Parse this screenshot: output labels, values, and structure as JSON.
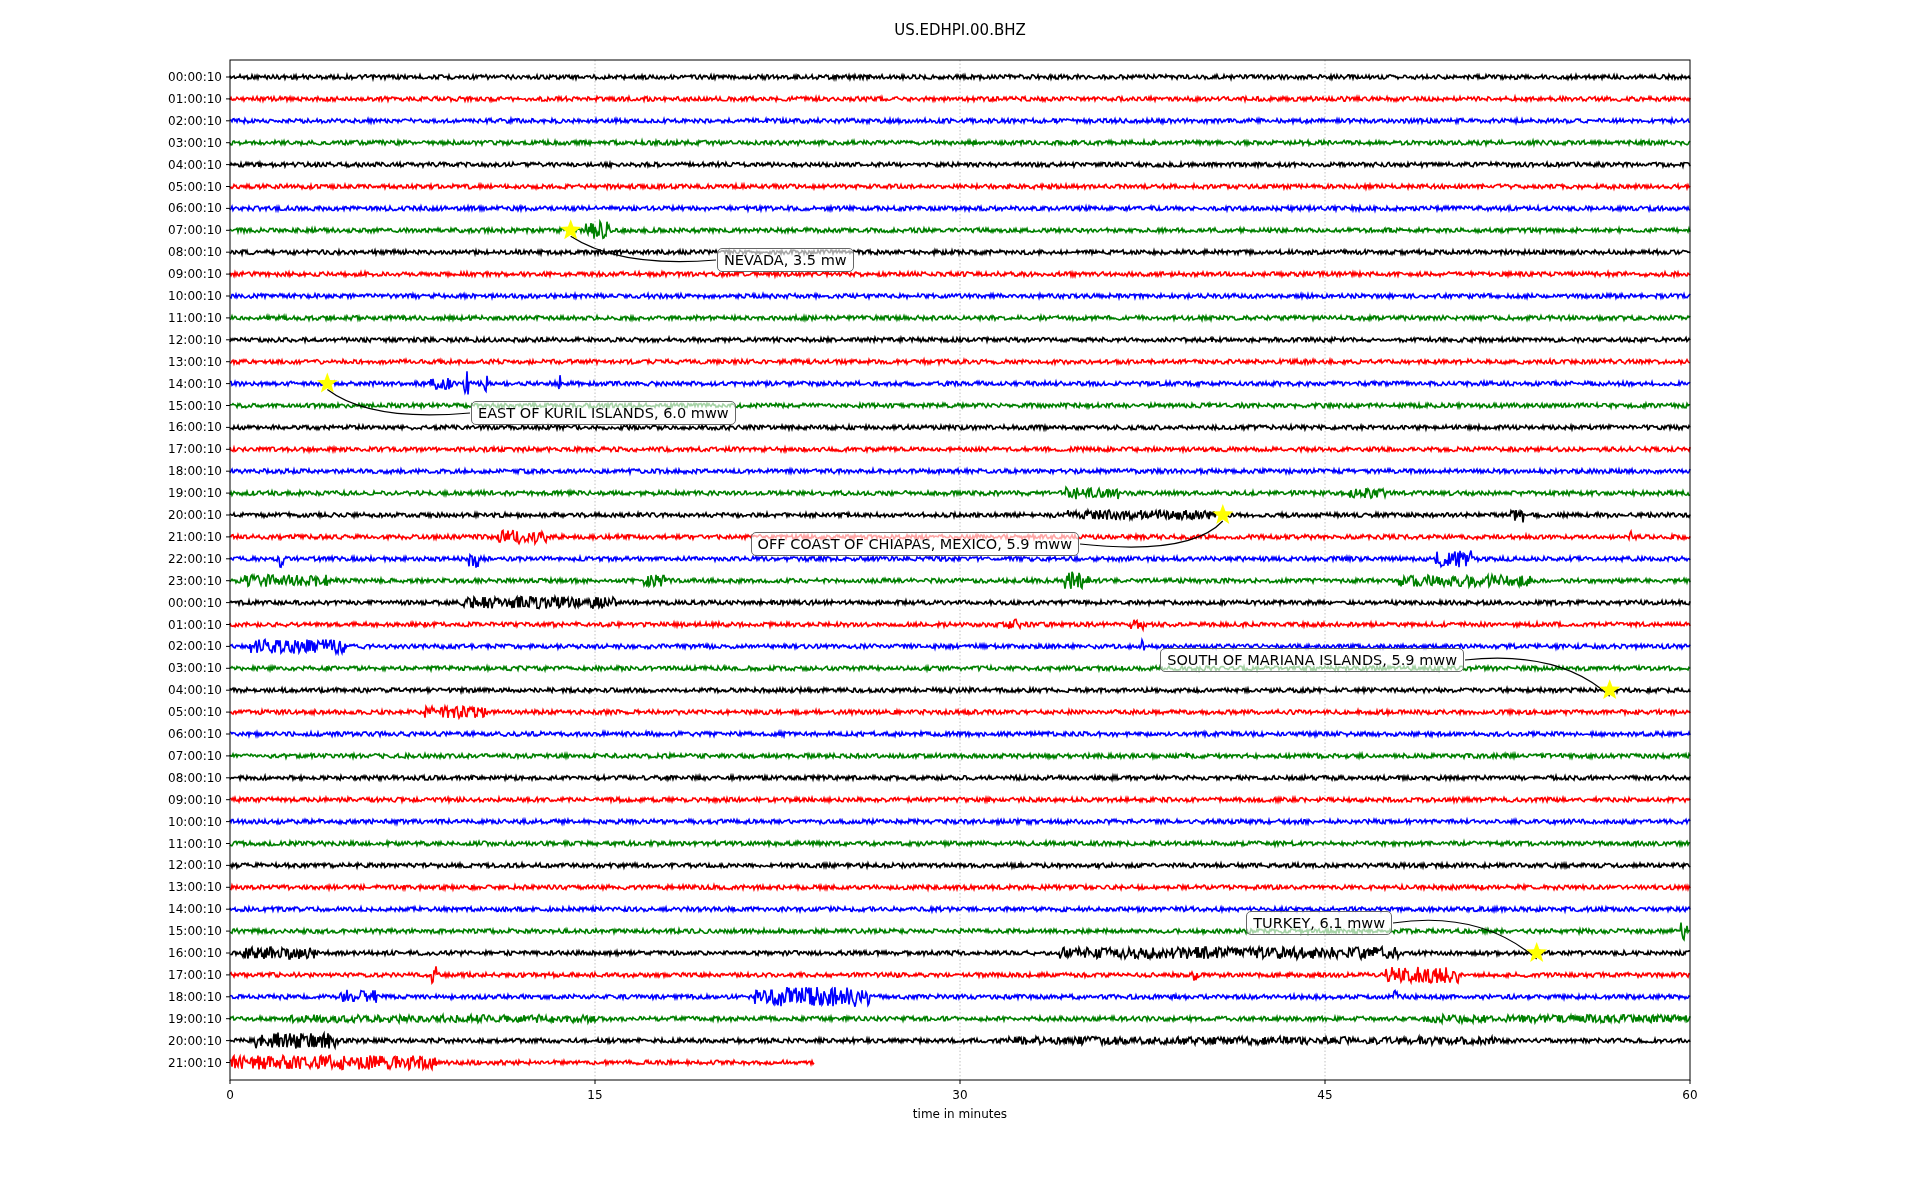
{
  "title": "US.EDHPI.00.BHZ",
  "xlabel": "time in minutes",
  "xticks": [
    "0",
    "15",
    "30",
    "45",
    "60"
  ],
  "rows": [
    {
      "label": "00:00:10",
      "color": "#000000"
    },
    {
      "label": "01:00:10",
      "color": "#ff0000"
    },
    {
      "label": "02:00:10",
      "color": "#0000ff"
    },
    {
      "label": "03:00:10",
      "color": "#008000"
    },
    {
      "label": "04:00:10",
      "color": "#000000"
    },
    {
      "label": "05:00:10",
      "color": "#ff0000"
    },
    {
      "label": "06:00:10",
      "color": "#0000ff"
    },
    {
      "label": "07:00:10",
      "color": "#008000",
      "event": {
        "label": "NEVADA, 3.5 mw"
      }
    },
    {
      "label": "08:00:10",
      "color": "#000000"
    },
    {
      "label": "09:00:10",
      "color": "#ff0000"
    },
    {
      "label": "10:00:10",
      "color": "#0000ff"
    },
    {
      "label": "11:00:10",
      "color": "#008000"
    },
    {
      "label": "12:00:10",
      "color": "#000000"
    },
    {
      "label": "13:00:10",
      "color": "#ff0000"
    },
    {
      "label": "14:00:10",
      "color": "#0000ff",
      "event": {
        "label": "EAST OF KURIL ISLANDS, 6.0 mww"
      }
    },
    {
      "label": "15:00:10",
      "color": "#008000"
    },
    {
      "label": "16:00:10",
      "color": "#000000"
    },
    {
      "label": "17:00:10",
      "color": "#ff0000"
    },
    {
      "label": "18:00:10",
      "color": "#0000ff"
    },
    {
      "label": "19:00:10",
      "color": "#008000"
    },
    {
      "label": "20:00:10",
      "color": "#000000",
      "event": {
        "label": "OFF COAST OF CHIAPAS, MEXICO, 5.9 mww"
      }
    },
    {
      "label": "21:00:10",
      "color": "#ff0000"
    },
    {
      "label": "22:00:10",
      "color": "#0000ff"
    },
    {
      "label": "23:00:10",
      "color": "#008000"
    },
    {
      "label": "00:00:10",
      "color": "#000000"
    },
    {
      "label": "01:00:10",
      "color": "#ff0000"
    },
    {
      "label": "02:00:10",
      "color": "#0000ff"
    },
    {
      "label": "03:00:10",
      "color": "#008000"
    },
    {
      "label": "04:00:10",
      "color": "#000000",
      "event": {
        "label": "SOUTH OF MARIANA ISLANDS, 5.9 mww"
      }
    },
    {
      "label": "05:00:10",
      "color": "#ff0000"
    },
    {
      "label": "06:00:10",
      "color": "#0000ff"
    },
    {
      "label": "07:00:10",
      "color": "#008000"
    },
    {
      "label": "08:00:10",
      "color": "#000000"
    },
    {
      "label": "09:00:10",
      "color": "#ff0000"
    },
    {
      "label": "10:00:10",
      "color": "#0000ff"
    },
    {
      "label": "11:00:10",
      "color": "#008000"
    },
    {
      "label": "12:00:10",
      "color": "#000000"
    },
    {
      "label": "13:00:10",
      "color": "#ff0000"
    },
    {
      "label": "14:00:10",
      "color": "#0000ff"
    },
    {
      "label": "15:00:10",
      "color": "#008000"
    },
    {
      "label": "16:00:10",
      "color": "#000000",
      "event": {
        "label": "TURKEY, 6.1 mww"
      }
    },
    {
      "label": "17:00:10",
      "color": "#ff0000"
    },
    {
      "label": "18:00:10",
      "color": "#0000ff"
    },
    {
      "label": "19:00:10",
      "color": "#008000"
    },
    {
      "label": "20:00:10",
      "color": "#000000"
    },
    {
      "label": "21:00:10",
      "color": "#ff0000",
      "partial": true
    }
  ]
}
